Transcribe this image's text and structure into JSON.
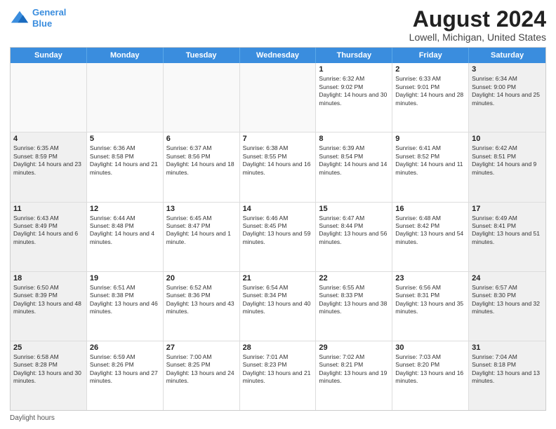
{
  "header": {
    "logo_line1": "General",
    "logo_line2": "Blue",
    "title": "August 2024",
    "subtitle": "Lowell, Michigan, United States"
  },
  "days_of_week": [
    "Sunday",
    "Monday",
    "Tuesday",
    "Wednesday",
    "Thursday",
    "Friday",
    "Saturday"
  ],
  "footer_label": "Daylight hours",
  "weeks": [
    [
      {
        "day": "",
        "empty": true
      },
      {
        "day": "",
        "empty": true
      },
      {
        "day": "",
        "empty": true
      },
      {
        "day": "",
        "empty": true
      },
      {
        "day": "1",
        "rise": "Sunrise: 6:32 AM",
        "set": "Sunset: 9:02 PM",
        "daylight": "Daylight: 14 hours and 30 minutes."
      },
      {
        "day": "2",
        "rise": "Sunrise: 6:33 AM",
        "set": "Sunset: 9:01 PM",
        "daylight": "Daylight: 14 hours and 28 minutes."
      },
      {
        "day": "3",
        "rise": "Sunrise: 6:34 AM",
        "set": "Sunset: 9:00 PM",
        "daylight": "Daylight: 14 hours and 25 minutes."
      }
    ],
    [
      {
        "day": "4",
        "rise": "Sunrise: 6:35 AM",
        "set": "Sunset: 8:59 PM",
        "daylight": "Daylight: 14 hours and 23 minutes."
      },
      {
        "day": "5",
        "rise": "Sunrise: 6:36 AM",
        "set": "Sunset: 8:58 PM",
        "daylight": "Daylight: 14 hours and 21 minutes."
      },
      {
        "day": "6",
        "rise": "Sunrise: 6:37 AM",
        "set": "Sunset: 8:56 PM",
        "daylight": "Daylight: 14 hours and 18 minutes."
      },
      {
        "day": "7",
        "rise": "Sunrise: 6:38 AM",
        "set": "Sunset: 8:55 PM",
        "daylight": "Daylight: 14 hours and 16 minutes."
      },
      {
        "day": "8",
        "rise": "Sunrise: 6:39 AM",
        "set": "Sunset: 8:54 PM",
        "daylight": "Daylight: 14 hours and 14 minutes."
      },
      {
        "day": "9",
        "rise": "Sunrise: 6:41 AM",
        "set": "Sunset: 8:52 PM",
        "daylight": "Daylight: 14 hours and 11 minutes."
      },
      {
        "day": "10",
        "rise": "Sunrise: 6:42 AM",
        "set": "Sunset: 8:51 PM",
        "daylight": "Daylight: 14 hours and 9 minutes."
      }
    ],
    [
      {
        "day": "11",
        "rise": "Sunrise: 6:43 AM",
        "set": "Sunset: 8:49 PM",
        "daylight": "Daylight: 14 hours and 6 minutes."
      },
      {
        "day": "12",
        "rise": "Sunrise: 6:44 AM",
        "set": "Sunset: 8:48 PM",
        "daylight": "Daylight: 14 hours and 4 minutes."
      },
      {
        "day": "13",
        "rise": "Sunrise: 6:45 AM",
        "set": "Sunset: 8:47 PM",
        "daylight": "Daylight: 14 hours and 1 minute."
      },
      {
        "day": "14",
        "rise": "Sunrise: 6:46 AM",
        "set": "Sunset: 8:45 PM",
        "daylight": "Daylight: 13 hours and 59 minutes."
      },
      {
        "day": "15",
        "rise": "Sunrise: 6:47 AM",
        "set": "Sunset: 8:44 PM",
        "daylight": "Daylight: 13 hours and 56 minutes."
      },
      {
        "day": "16",
        "rise": "Sunrise: 6:48 AM",
        "set": "Sunset: 8:42 PM",
        "daylight": "Daylight: 13 hours and 54 minutes."
      },
      {
        "day": "17",
        "rise": "Sunrise: 6:49 AM",
        "set": "Sunset: 8:41 PM",
        "daylight": "Daylight: 13 hours and 51 minutes."
      }
    ],
    [
      {
        "day": "18",
        "rise": "Sunrise: 6:50 AM",
        "set": "Sunset: 8:39 PM",
        "daylight": "Daylight: 13 hours and 48 minutes."
      },
      {
        "day": "19",
        "rise": "Sunrise: 6:51 AM",
        "set": "Sunset: 8:38 PM",
        "daylight": "Daylight: 13 hours and 46 minutes."
      },
      {
        "day": "20",
        "rise": "Sunrise: 6:52 AM",
        "set": "Sunset: 8:36 PM",
        "daylight": "Daylight: 13 hours and 43 minutes."
      },
      {
        "day": "21",
        "rise": "Sunrise: 6:54 AM",
        "set": "Sunset: 8:34 PM",
        "daylight": "Daylight: 13 hours and 40 minutes."
      },
      {
        "day": "22",
        "rise": "Sunrise: 6:55 AM",
        "set": "Sunset: 8:33 PM",
        "daylight": "Daylight: 13 hours and 38 minutes."
      },
      {
        "day": "23",
        "rise": "Sunrise: 6:56 AM",
        "set": "Sunset: 8:31 PM",
        "daylight": "Daylight: 13 hours and 35 minutes."
      },
      {
        "day": "24",
        "rise": "Sunrise: 6:57 AM",
        "set": "Sunset: 8:30 PM",
        "daylight": "Daylight: 13 hours and 32 minutes."
      }
    ],
    [
      {
        "day": "25",
        "rise": "Sunrise: 6:58 AM",
        "set": "Sunset: 8:28 PM",
        "daylight": "Daylight: 13 hours and 30 minutes."
      },
      {
        "day": "26",
        "rise": "Sunrise: 6:59 AM",
        "set": "Sunset: 8:26 PM",
        "daylight": "Daylight: 13 hours and 27 minutes."
      },
      {
        "day": "27",
        "rise": "Sunrise: 7:00 AM",
        "set": "Sunset: 8:25 PM",
        "daylight": "Daylight: 13 hours and 24 minutes."
      },
      {
        "day": "28",
        "rise": "Sunrise: 7:01 AM",
        "set": "Sunset: 8:23 PM",
        "daylight": "Daylight: 13 hours and 21 minutes."
      },
      {
        "day": "29",
        "rise": "Sunrise: 7:02 AM",
        "set": "Sunset: 8:21 PM",
        "daylight": "Daylight: 13 hours and 19 minutes."
      },
      {
        "day": "30",
        "rise": "Sunrise: 7:03 AM",
        "set": "Sunset: 8:20 PM",
        "daylight": "Daylight: 13 hours and 16 minutes."
      },
      {
        "day": "31",
        "rise": "Sunrise: 7:04 AM",
        "set": "Sunset: 8:18 PM",
        "daylight": "Daylight: 13 hours and 13 minutes."
      }
    ]
  ]
}
